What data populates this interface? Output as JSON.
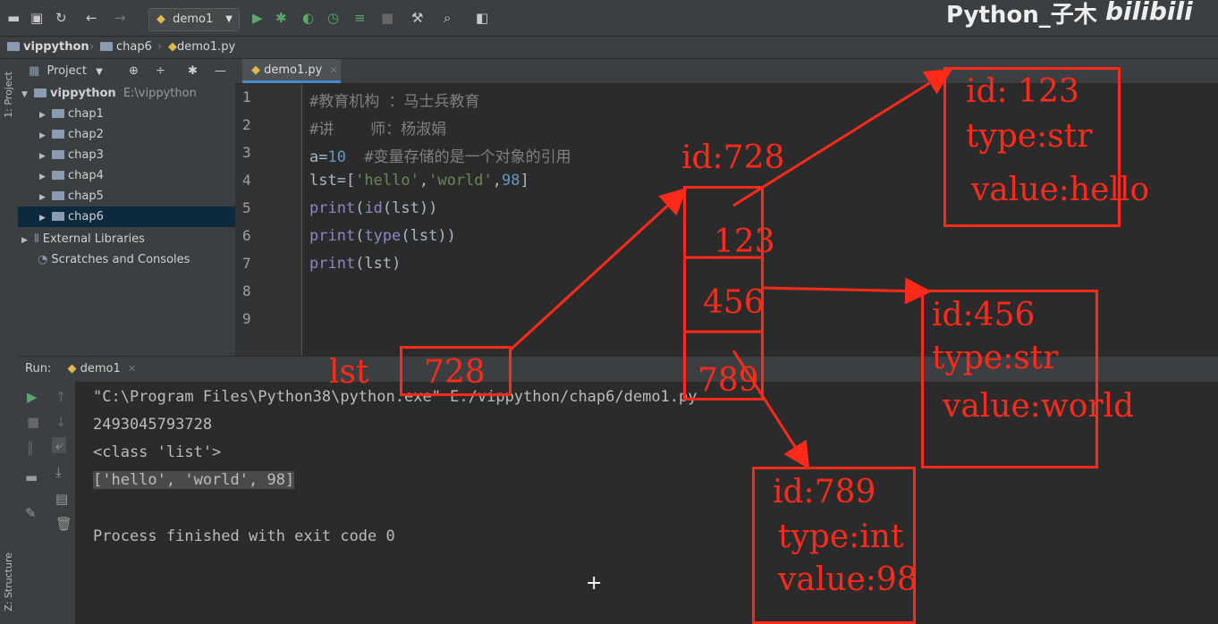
{
  "toolbar": {
    "run_config": "demo1"
  },
  "brand": {
    "title": "Python_子木",
    "logo": "bilibili"
  },
  "breadcrumb": [
    "vippython",
    "chap6",
    "demo1.py"
  ],
  "side_labels": {
    "project": "1: Project",
    "structure": "Z: Structure"
  },
  "project_panel": {
    "header": "Project",
    "root": {
      "name": "vippython",
      "path": "E:\\vippython"
    },
    "folders": [
      "chap1",
      "chap2",
      "chap3",
      "chap4",
      "chap5",
      "chap6"
    ],
    "selected": "chap6",
    "external_libraries": "External Libraries",
    "scratches": "Scratches and Consoles"
  },
  "editor": {
    "tab": "demo1.py",
    "lines": [
      {
        "n": "1",
        "parts": [
          {
            "t": "#教育机构 ：马士兵教育",
            "c": "cmt"
          }
        ]
      },
      {
        "n": "2",
        "parts": [
          {
            "t": "#讲    师：杨淑娟",
            "c": "cmt"
          }
        ]
      },
      {
        "n": "3",
        "parts": [
          {
            "t": "a=",
            "c": ""
          },
          {
            "t": "10",
            "c": "num"
          },
          {
            "t": "  #变量存储的是一个对象的引用",
            "c": "cmt"
          }
        ]
      },
      {
        "n": "4",
        "parts": [
          {
            "t": "lst=[",
            "c": ""
          },
          {
            "t": "'hello'",
            "c": "str"
          },
          {
            "t": ",",
            "c": ""
          },
          {
            "t": "'world'",
            "c": "str"
          },
          {
            "t": ",",
            "c": ""
          },
          {
            "t": "98",
            "c": "num"
          },
          {
            "t": "]",
            "c": ""
          }
        ]
      },
      {
        "n": "5",
        "parts": [
          {
            "t": "print",
            "c": "bi"
          },
          {
            "t": "(",
            "c": ""
          },
          {
            "t": "id",
            "c": "bi"
          },
          {
            "t": "(lst))",
            "c": ""
          }
        ]
      },
      {
        "n": "6",
        "parts": [
          {
            "t": "print",
            "c": "bi"
          },
          {
            "t": "(",
            "c": ""
          },
          {
            "t": "type",
            "c": "bi"
          },
          {
            "t": "(lst))",
            "c": ""
          }
        ]
      },
      {
        "n": "7",
        "parts": [
          {
            "t": "print",
            "c": "bi"
          },
          {
            "t": "(lst)",
            "c": ""
          }
        ]
      },
      {
        "n": "8",
        "parts": []
      },
      {
        "n": "9",
        "parts": []
      }
    ]
  },
  "run_panel": {
    "label": "Run:",
    "tab": "demo1",
    "output": {
      "cmd": "\"C:\\Program Files\\Python38\\python.exe\" E:/vippython/chap6/demo1.py",
      "id_value": "2493045793728",
      "type_value": "<class 'list'>",
      "list_value": "['hello', 'world', 98]",
      "exit": "Process finished with exit code 0"
    }
  },
  "annotations": {
    "lst_label": "lst",
    "lst_ref": "728",
    "list_id": "id:728",
    "slots": [
      "123",
      "456",
      "789"
    ],
    "obj_hello": {
      "id": "id: 123",
      "type": "type:str",
      "value": "value:hello"
    },
    "obj_world": {
      "id": "id:456",
      "type": "type:str",
      "value": "value:world"
    },
    "obj_98": {
      "id": "id:789",
      "type": "type:int",
      "value": "value:98"
    },
    "color": "#ff2a1a"
  }
}
